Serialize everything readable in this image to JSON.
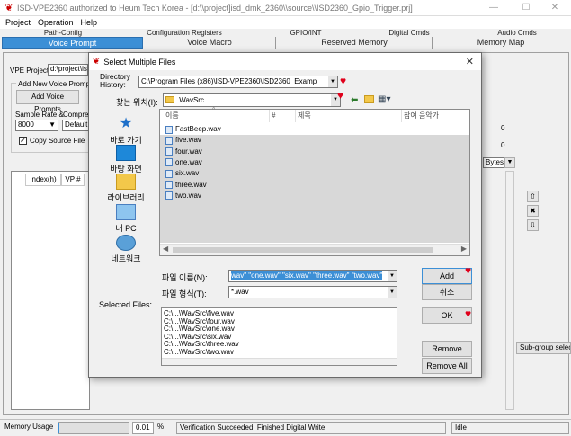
{
  "window": {
    "title": "ISD-VPE2360 authorized to Heum Tech Korea - [d:\\\\project]isd_dmk_2360\\\\source\\\\ISD2360_Gpio_Trigger.prj]",
    "minimize": "—",
    "maximize": "☐",
    "close": "✕"
  },
  "menu": [
    "Project",
    "Operation",
    "Help"
  ],
  "tabs_top": [
    "Path-Config",
    "Configuration Registers",
    "GPIO/INT",
    "Digital Cmds",
    "Audio Cmds"
  ],
  "tabs_main": [
    "Voice Prompt",
    "Voice Macro",
    "Reserved Memory",
    "Memory Map"
  ],
  "main": {
    "vpe_project_label": "VPE Project",
    "vpe_project_value": "d:\\project\\is",
    "add_group_label": "Add New Voice Prompts",
    "add_button": "Add Voice Prompts",
    "sample_rate_label": "Sample Rate &",
    "compress_label": "Compres",
    "sample_rate_value": "8000",
    "compress_value": "Default",
    "copy_source_label": "Copy Source File To",
    "table_cols": [
      "Index(h)",
      "VP #"
    ],
    "right_val1": "0",
    "right_val2": "0",
    "bytes_select": "Bytes)",
    "subgroup_button": "Sub-group selecti"
  },
  "dialog": {
    "title": "Select Multiple Files",
    "close": "✕",
    "dir_history_label": "Directory History:",
    "dir_history_value": "C:\\Program Files (x86)\\ISD-VPE2360\\ISD2360_Examp",
    "look_in_label": "찾는 위치(I):",
    "look_in_value": "WavSrc",
    "places": [
      "바로 가기",
      "바탕 화면",
      "라이브러리",
      "내 PC",
      "네트워크"
    ],
    "columns": [
      "이름",
      "#",
      "제목",
      "참여 음악가"
    ],
    "files": [
      {
        "name": "FastBeep.wav",
        "selected": false
      },
      {
        "name": "five.wav",
        "selected": true
      },
      {
        "name": "four.wav",
        "selected": true
      },
      {
        "name": "one.wav",
        "selected": true
      },
      {
        "name": "six.wav",
        "selected": true
      },
      {
        "name": "three.wav",
        "selected": true
      },
      {
        "name": "two.wav",
        "selected": true
      }
    ],
    "filename_label": "파일 이름(N):",
    "filename_value": "wav\" \"one.wav\" \"six.wav\" \"three.wav\" \"two.wav\"",
    "filetype_label": "파일 형식(T):",
    "filetype_value": "*.wav",
    "add_button": "Add",
    "cancel_button": "취소",
    "ok_button": "OK",
    "selected_files_label": "Selected Files:",
    "selected_files": [
      "C:\\...\\WavSrc\\five.wav",
      "C:\\...\\WavSrc\\four.wav",
      "C:\\...\\WavSrc\\one.wav",
      "C:\\...\\WavSrc\\six.wav",
      "C:\\...\\WavSrc\\three.wav",
      "C:\\...\\WavSrc\\two.wav"
    ],
    "remove_button": "Remove",
    "remove_all_button": "Remove All"
  },
  "status": {
    "memory_label": "Memory Usage",
    "memory_value": "0.01",
    "memory_unit": "%",
    "message": "Verification Succeeded, Finished Digital Write.",
    "state": "Idle"
  },
  "colors": {
    "accent": "#3c8fd6",
    "heart": "#e0001b",
    "selection": "#d8d8d8"
  }
}
